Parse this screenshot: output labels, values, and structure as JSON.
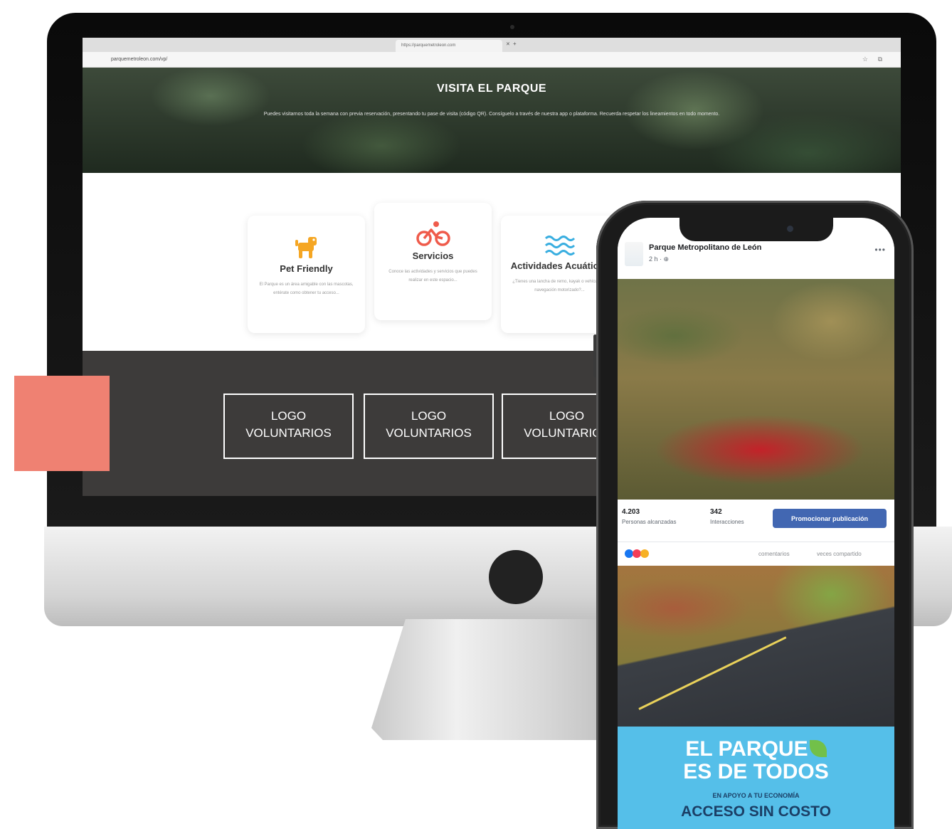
{
  "colors": {
    "coral": "#ef8172",
    "voluntarios_bg": "#3d3b3a",
    "promo_blue": "#55bfe9",
    "fb_button": "#4267b2",
    "pet_icon": "#f5a623",
    "bike_icon": "#ef5b4b",
    "water_icon": "#39aee0"
  },
  "browser": {
    "tab_title": "https://parquemetroleon.com",
    "url": "parquemetroleon.com/vp/"
  },
  "hero": {
    "title": "VISITA EL PARQUE",
    "text": "Puedes visitarnos toda la semana con previa reservación, presentando tu pase de visita (código QR). Consíguelo a través de nuestra app o plataforma. Recuerda respetar los lineamientos en todo momento."
  },
  "cards": [
    {
      "icon": "dog-icon",
      "title": "Pet Friendly",
      "description": "El Parque es un área amigable con las mascotas, entérate como obtener tu acceso..."
    },
    {
      "icon": "bicycle-icon",
      "title": "Servicios",
      "description": "Conoce las actividades y servicios que puedes realizar en este espacio..."
    },
    {
      "icon": "water-waves-icon",
      "title": "Actividades Acuáticas",
      "description": "¿Tienes una lancha de remo, kayak o vehículo de navegación motorizado?..."
    }
  ],
  "voluntarios": [
    {
      "line1": "LOGO",
      "line2": "VOLUNTARIOS"
    },
    {
      "line1": "LOGO",
      "line2": "VOLUNTARIOS"
    },
    {
      "line1": "LOGO",
      "line2": "VOLUNTARIOS"
    }
  ],
  "phone": {
    "page_name": "Parque Metropolitano de León",
    "post_time": "2 h · ⊕",
    "stats": [
      {
        "value": "4.203",
        "label": "Personas alcanzadas"
      },
      {
        "value": "342",
        "label": "Interacciones"
      }
    ],
    "promote_button": "Promocionar publicación",
    "comments_label": "comentarios",
    "shares_label": "veces compartido",
    "promo": {
      "line1": "EL PARQUE",
      "line2": "ES DE TODOS",
      "subline": "EN APOYO A TU ECONOMÍA",
      "line3": "ACCESO SIN COSTO"
    }
  }
}
